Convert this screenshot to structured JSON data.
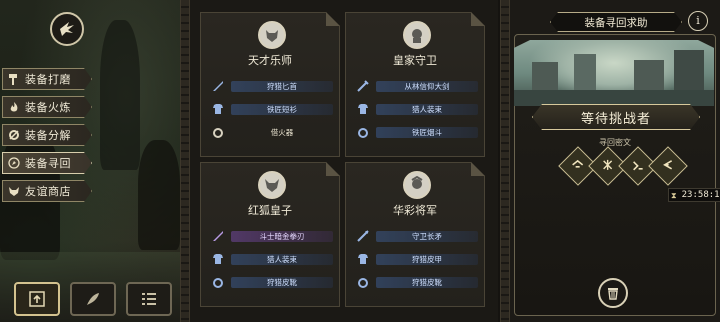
{
  "sidebar": {
    "items": [
      {
        "label": "装备打磨",
        "icon": "hammer-icon"
      },
      {
        "label": "装备火炼",
        "icon": "flame-icon"
      },
      {
        "label": "装备分解",
        "icon": "gear-break-icon"
      },
      {
        "label": "装备寻回",
        "icon": "compass-icon",
        "active": true
      },
      {
        "label": "友谊商店",
        "icon": "fox-icon"
      }
    ]
  },
  "characters": [
    {
      "name": "天才乐师",
      "items": [
        {
          "text": "狩猎匕首",
          "style": "blue",
          "icon": "dagger-icon"
        },
        {
          "text": "铁匠短衫",
          "style": "blue",
          "icon": "armor-icon"
        },
        {
          "text": "借火器",
          "style": "plain",
          "icon": "ring-icon"
        }
      ]
    },
    {
      "name": "皇家守卫",
      "items": [
        {
          "text": "从林信仰大剑",
          "style": "blue",
          "icon": "sword-icon"
        },
        {
          "text": "猎人装束",
          "style": "blue",
          "icon": "armor-icon"
        },
        {
          "text": "铁匠烟斗",
          "style": "blue",
          "icon": "ring-icon"
        }
      ]
    },
    {
      "name": "红狐皇子",
      "items": [
        {
          "text": "斗士暗金拳刃",
          "style": "purple",
          "icon": "blade-icon"
        },
        {
          "text": "猎人装束",
          "style": "blue",
          "icon": "armor-icon"
        },
        {
          "text": "狩猎皮靴",
          "style": "blue",
          "icon": "ring-icon"
        }
      ]
    },
    {
      "name": "华彩将军",
      "items": [
        {
          "text": "守卫长矛",
          "style": "blue",
          "icon": "spear-icon"
        },
        {
          "text": "狩猎皮甲",
          "style": "blue",
          "icon": "armor-icon"
        },
        {
          "text": "狩猎皮靴",
          "style": "blue",
          "icon": "ring-icon"
        }
      ]
    }
  ],
  "panel": {
    "title": "装备寻回求助",
    "info_label": "i",
    "status": "等待挑战者",
    "cipher_label": "寻回密文",
    "glyphs": [
      "glyph-1-icon",
      "glyph-2-icon",
      "glyph-3-icon",
      "glyph-4-icon"
    ],
    "timer": "23:58:12"
  },
  "bottom_buttons": [
    "upload-icon",
    "feather-icon",
    "list-icon"
  ]
}
